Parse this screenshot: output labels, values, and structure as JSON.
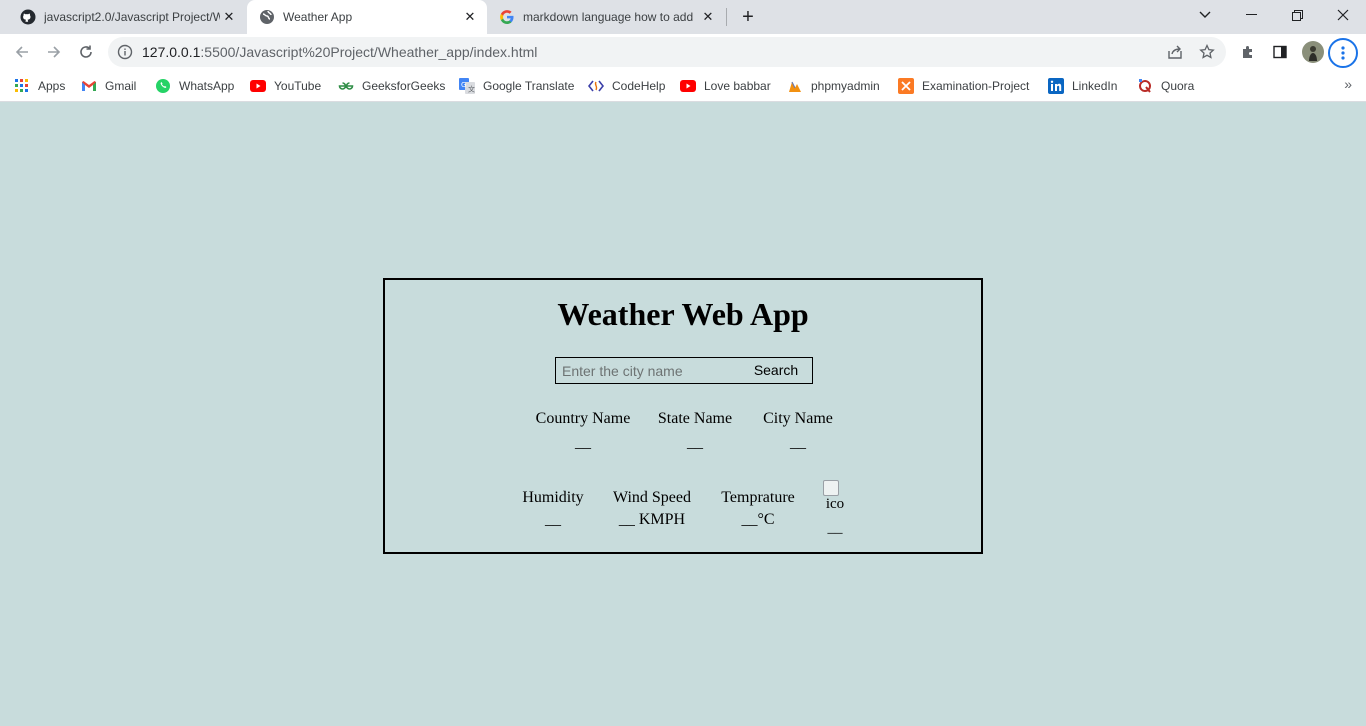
{
  "browser": {
    "tabs": [
      {
        "title": "javascript2.0/Javascript Project/W",
        "icon": "github-icon",
        "active": false
      },
      {
        "title": "Weather App",
        "icon": "globe-icon",
        "active": true
      },
      {
        "title": "markdown language how to add",
        "icon": "google-icon",
        "active": false
      }
    ],
    "address": {
      "host": "127.0.0.1",
      "path": ":5500/Javascript%20Project/Wheather_app/index.html"
    },
    "bookmarks": [
      {
        "label": "Apps",
        "icon": "apps-grid-icon"
      },
      {
        "label": "Gmail",
        "icon": "gmail-icon"
      },
      {
        "label": "WhatsApp",
        "icon": "whatsapp-icon"
      },
      {
        "label": "YouTube",
        "icon": "youtube-icon"
      },
      {
        "label": "GeeksforGeeks",
        "icon": "geeksforgeeks-icon"
      },
      {
        "label": "Google Translate",
        "icon": "google-translate-icon"
      },
      {
        "label": "CodeHelp",
        "icon": "codehelp-icon"
      },
      {
        "label": "Love babbar",
        "icon": "youtube-icon"
      },
      {
        "label": "phpmyadmin",
        "icon": "phpmyadmin-icon"
      },
      {
        "label": "Examination-Project",
        "icon": "xampp-icon"
      },
      {
        "label": "LinkedIn",
        "icon": "linkedin-icon"
      },
      {
        "label": "Quora",
        "icon": "quora-icon"
      }
    ],
    "more_bookmarks": "»"
  },
  "app": {
    "title": "Weather Web App",
    "search": {
      "placeholder": "Enter the city name",
      "button": "Search"
    },
    "location": {
      "country": {
        "label": "Country Name",
        "value": "__"
      },
      "state": {
        "label": "State Name",
        "value": "__"
      },
      "city": {
        "label": "City Name",
        "value": "__"
      }
    },
    "weather": {
      "humidity": {
        "label": "Humidity",
        "value": "__"
      },
      "wind": {
        "label": "Wind Speed",
        "value": "__ KMPH"
      },
      "temperature": {
        "label": "Temprature",
        "value": "__°C"
      },
      "icon": {
        "alt": "ico",
        "value": "__"
      }
    }
  },
  "colors": {
    "page_bg": "#c8dcdc",
    "accent": "#1a73e8"
  }
}
